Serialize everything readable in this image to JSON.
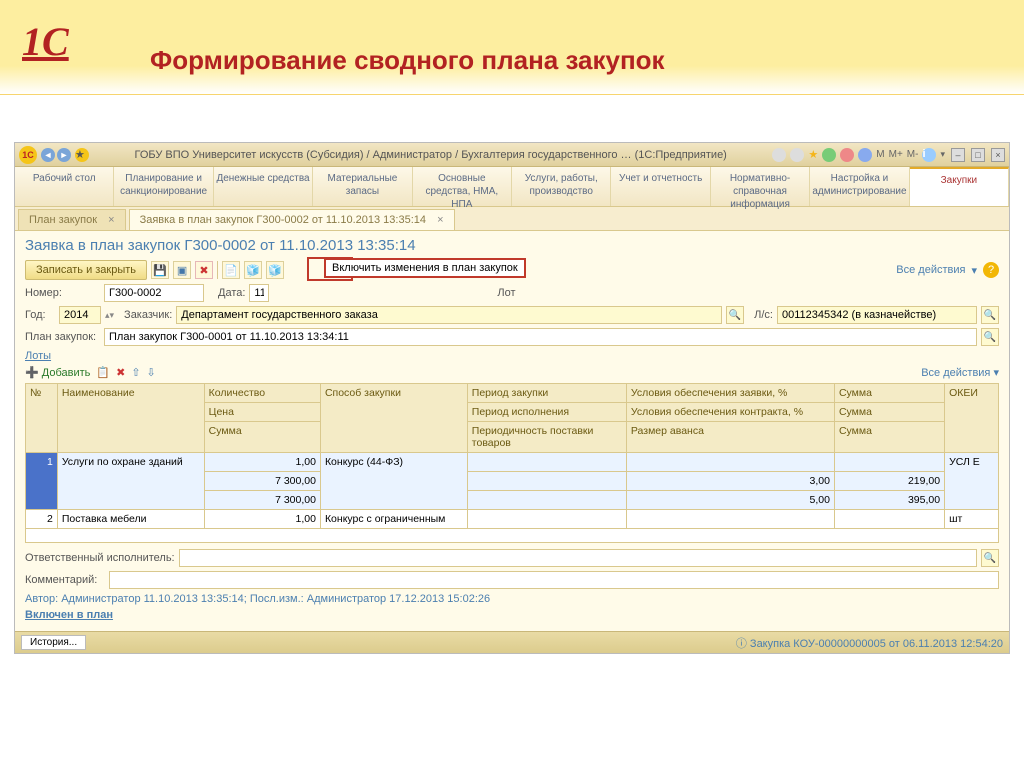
{
  "slide": {
    "title": "Формирование сводного плана закупок",
    "logo": "1С"
  },
  "window": {
    "title": "ГОБУ ВПО Университет искусств (Субсидия) / Администратор / Бухгалтерия государственного …  (1С:Предприятие)",
    "mlabels": [
      "M",
      "M+",
      "M-"
    ]
  },
  "topnav": [
    "Рабочий стол",
    "Планирование и санкционирование",
    "Денежные средства",
    "Материальные запасы",
    "Основные средства, НМА, НПА",
    "Услуги, работы, производство",
    "Учет и отчетность",
    "Нормативно-справочная информация",
    "Настройка и администрирование",
    "Закупки"
  ],
  "doctabs": [
    {
      "label": "План закупок",
      "active": false
    },
    {
      "label": "Заявка в план закупок Г300-0002 от 11.10.2013 13:35:14",
      "active": true
    }
  ],
  "doc": {
    "title": "Заявка в план закупок Г300-0002 от 11.10.2013 13:35:14",
    "btn_save": "Записать и закрыть",
    "all_actions": "Все действия",
    "callout": "Включить изменения в план закупок",
    "number_label": "Номер:",
    "number": "Г300-0002",
    "date_label": "Дата:",
    "date": "11",
    "lot_label": "Лот",
    "year_label": "Год:",
    "year": "2014",
    "customer_label": "Заказчик:",
    "customer": "Департамент государственного заказа",
    "ls_label": "Л/с:",
    "ls": "00112345342 (в казначействе)",
    "plan_label": "План закупок:",
    "plan": "План закупок Г300-0001 от 11.10.2013 13:34:11",
    "lots": "Лоты",
    "add": "Добавить"
  },
  "grid": {
    "headers": {
      "n": "№",
      "name": "Наименование",
      "qty": "Количество",
      "price": "Цена",
      "sum": "Сумма",
      "method": "Способ закупки",
      "period": "Период закупки",
      "exec": "Период исполнения",
      "freq": "Периодичность поставки товаров",
      "cond_app": "Условия обеспечения заявки, %",
      "cond_ctr": "Условия обеспечения контракта, %",
      "advance": "Размер аванса",
      "sum2": "Сумма",
      "okei": "ОКЕИ"
    },
    "rows": [
      {
        "n": "1",
        "name": "Услуги по охране зданий",
        "qty": "1,00",
        "price": "7 300,00",
        "sum": "7 300,00",
        "method": "Конкурс (44-ФЗ)",
        "cond_app": "",
        "cond_ctr": "3,00",
        "advance": "5,00",
        "sum2a": "",
        "sum2b": "219,00",
        "sum2c": "395,00",
        "okei": "УСЛ Е"
      },
      {
        "n": "2",
        "name": "Поставка мебели",
        "qty": "1,00",
        "price": "",
        "sum": "",
        "method": "Конкурс с ограниченным",
        "cond_app": "",
        "cond_ctr": "",
        "advance": "",
        "sum2a": "",
        "sum2b": "",
        "sum2c": "",
        "okei": "шт"
      }
    ]
  },
  "footer": {
    "resp_label": "Ответственный исполнитель:",
    "comment_label": "Комментарий:",
    "author": "Автор: Администратор 11.10.2013 13:35:14; Посл.изм.: Администратор 17.12.2013 15:02:26",
    "included": "Включен в план",
    "history": "История...",
    "status_right": "Закупка КОУ-00000000005 от 06.11.2013 12:54:20"
  }
}
